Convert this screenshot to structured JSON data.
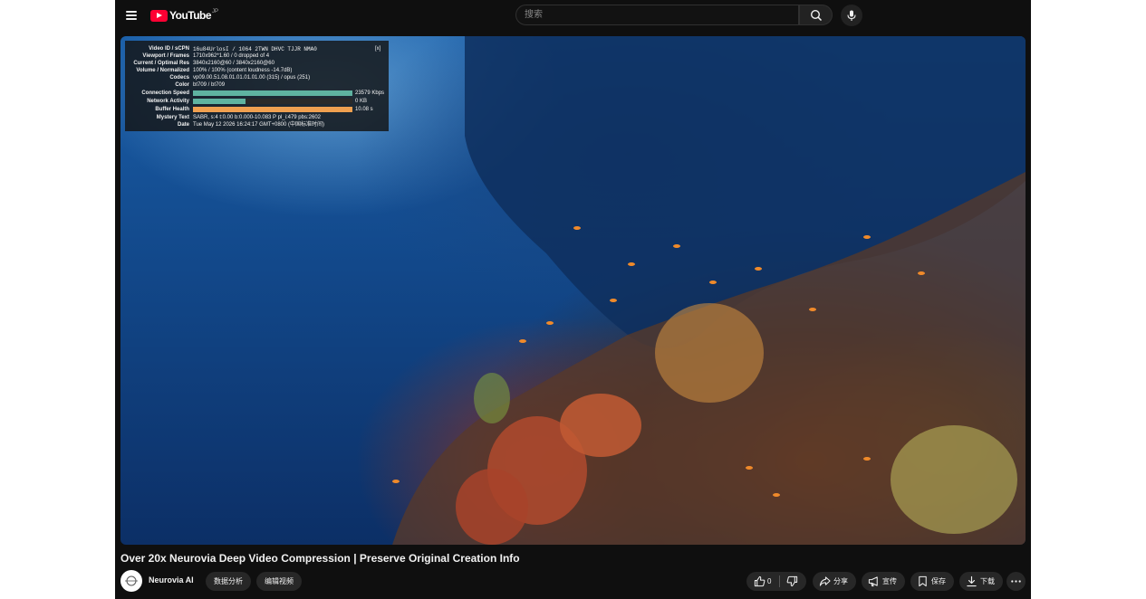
{
  "header": {
    "logo_text": "YouTube",
    "logo_region": "JP",
    "search_placeholder": "搜索"
  },
  "stats": {
    "close_label": "[x]",
    "rows": [
      {
        "label": "Video ID / sCPN",
        "value": "16u84UrlosI / 1064 2TWN DHVC TJJR NMA0"
      },
      {
        "label": "Viewport / Frames",
        "value": "1710x962*1.60 / 0 dropped of 4"
      },
      {
        "label": "Current / Optimal Res",
        "value": "3840x2160@60 / 3840x2160@60"
      },
      {
        "label": "Volume / Normalized",
        "value": "100% / 100% (content loudness -14.7dB)"
      },
      {
        "label": "Codecs",
        "value": "vp09.00.51.08.01.01.01.01.00 (315) / opus (251)"
      },
      {
        "label": "Color",
        "value": "bt709 / bt709"
      },
      {
        "label": "Connection Speed",
        "value": "23579 Kbps",
        "fill": 1.0
      },
      {
        "label": "Network Activity",
        "value": "0 KB",
        "fill": 0.33
      },
      {
        "label": "Buffer Health",
        "value": "10.08 s",
        "fill": 1.0
      },
      {
        "label": "Mystery Text",
        "value": "SABR, s:4 t:0.00 b:0.000-10.083 P pl_i:479 pbs:2602"
      },
      {
        "label": "Date",
        "value": "Tue May 12 2026 16:24:17 GMT+0800 (中国标准时间)"
      }
    ],
    "colors": {
      "speed": "#5fb3a0",
      "network": "#5fb3a0",
      "buffer": "#f0a050"
    }
  },
  "video": {
    "title": "Over 20x Neurovia Deep Video Compression | Preserve Original Creation Info",
    "channel": "Neurovia AI",
    "channel_buttons": [
      "数据分析",
      "编辑视频"
    ],
    "like_count": "0",
    "actions": {
      "share": "分享",
      "promote": "宣传",
      "save": "保存",
      "download": "下载"
    }
  }
}
